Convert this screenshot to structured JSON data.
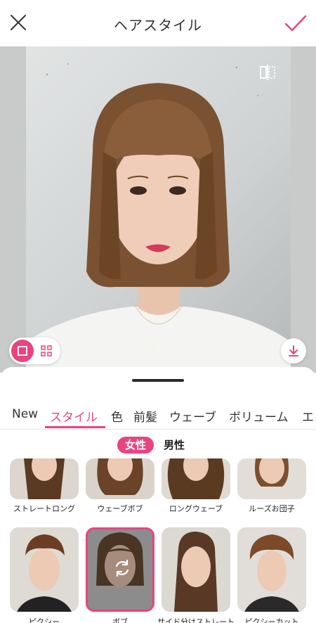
{
  "header": {
    "title": "ヘアスタイル",
    "close_icon": "close-icon",
    "confirm_icon": "checkmark-icon"
  },
  "colors": {
    "accent": "#e94481",
    "text": "#222222",
    "divider": "#e4e4e4"
  },
  "photo": {
    "compare_icon": "compare-split-icon",
    "view_toggle": {
      "single_icon": "single-view-icon",
      "grid_icon": "grid-view-icon",
      "selected": "single"
    },
    "download_icon": "download-icon"
  },
  "tabs": [
    {
      "label": "New",
      "active": false
    },
    {
      "label": "スタイル",
      "active": true
    },
    {
      "label": "色",
      "active": false
    },
    {
      "label": "前髪",
      "active": false
    },
    {
      "label": "ウェーブ",
      "active": false
    },
    {
      "label": "ボリューム",
      "active": false
    },
    {
      "label": "エ",
      "active": false
    }
  ],
  "gender": {
    "female": "女性",
    "male": "男性",
    "selected": "female"
  },
  "styles_row1": [
    {
      "label": "ストレートロング"
    },
    {
      "label": "ウェーブボブ"
    },
    {
      "label": "ロングウェーブ"
    },
    {
      "label": "ルーズお団子"
    }
  ],
  "styles_row2": [
    {
      "label": "ピクシー",
      "selected": false
    },
    {
      "label": "ボブ",
      "selected": true
    },
    {
      "label": "サイド分けストレート",
      "selected": false
    },
    {
      "label": "ピクシーカット",
      "selected": false
    }
  ]
}
